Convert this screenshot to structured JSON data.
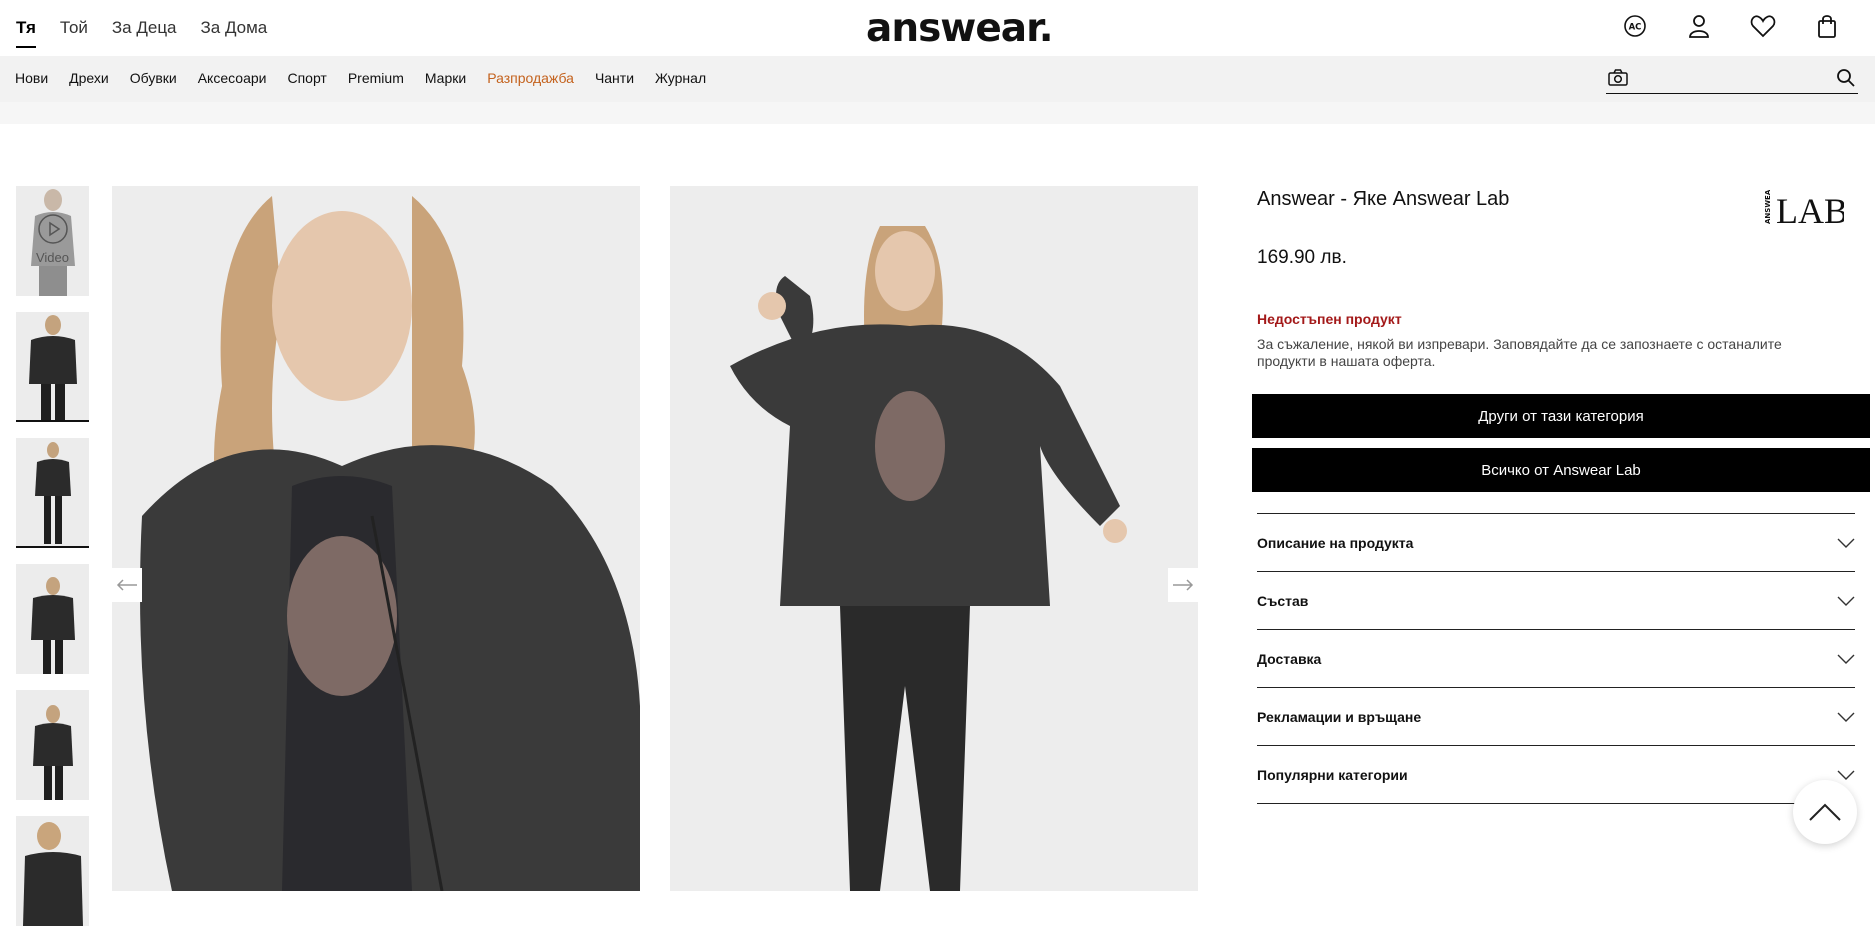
{
  "header": {
    "gender_tabs": [
      "Тя",
      "Той",
      "За Деца",
      "За Дома"
    ],
    "logo_text": "answear.",
    "icons": [
      "accessibility-icon",
      "user-icon",
      "heart-icon",
      "bag-icon"
    ]
  },
  "nav": {
    "items": [
      "Нови",
      "Дрехи",
      "Обувки",
      "Аксесоари",
      "Спорт",
      "Premium",
      "Марки",
      "Разпродажба",
      "Чанти",
      "Журнал"
    ],
    "sale_color": "#c4621d",
    "search_placeholder": ""
  },
  "gallery": {
    "video_label": "Video"
  },
  "product": {
    "title": "Answear - Яке Answear Lab",
    "brand_logo_text": "LAB",
    "brand_logo_small": "ANSWEAR",
    "price": "169.90 лв.",
    "unavailable_title": "Недостъпен продукт",
    "unavailable_msg": "За съжаление, някой ви изпревари. Заповядайте да се запознаете с останалите продукти в нашата оферта.",
    "btn_category": "Други от тази категория",
    "btn_brand": "Всичко от Answear Lab",
    "accordion": [
      "Описание на продукта",
      "Състав",
      "Доставка",
      "Рекламации и връщане",
      "Популярни категории"
    ]
  },
  "colors": {
    "unavailable": "#a31919",
    "button_bg": "#000000"
  }
}
